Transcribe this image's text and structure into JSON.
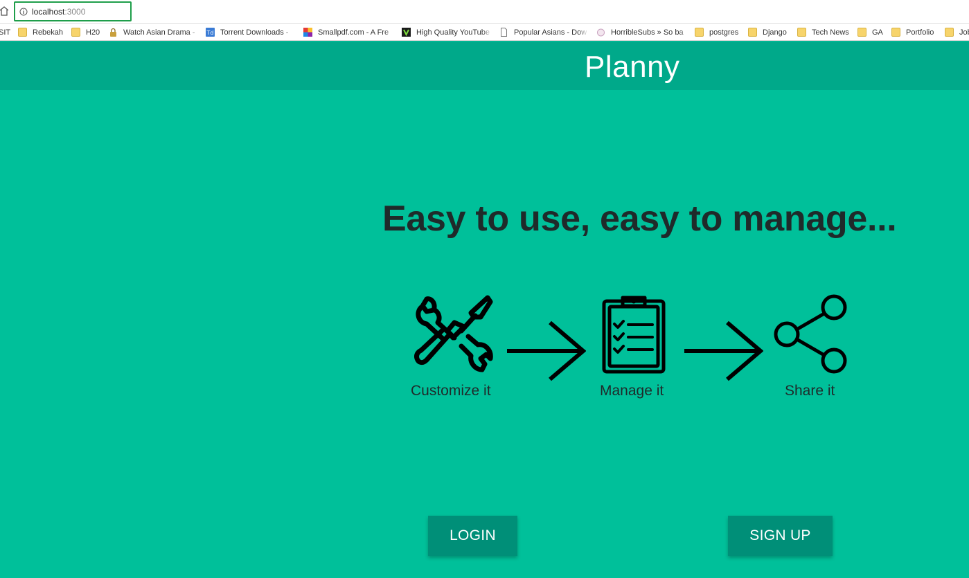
{
  "browser": {
    "url_host": "localhost",
    "url_port": ":3000",
    "bookmarks": [
      {
        "label": "SIT",
        "icon": "none"
      },
      {
        "label": "Rebekah",
        "icon": "folder-icon"
      },
      {
        "label": "H20",
        "icon": "folder-icon"
      },
      {
        "label": "Watch Asian Drama -",
        "icon": "lock-icon"
      },
      {
        "label": "Torrent Downloads -",
        "icon": "td-icon"
      },
      {
        "label": "Smallpdf.com - A Fre",
        "icon": "smallpdf-icon"
      },
      {
        "label": "High Quality YouTube",
        "icon": "v-icon"
      },
      {
        "label": "Popular Asians - Dow",
        "icon": "page-icon"
      },
      {
        "label": "HorribleSubs » So ba",
        "icon": "hs-icon"
      },
      {
        "label": "postgres",
        "icon": "folder-icon"
      },
      {
        "label": "Django",
        "icon": "folder-icon"
      },
      {
        "label": "Tech News",
        "icon": "folder-icon"
      },
      {
        "label": "GA",
        "icon": "folder-icon"
      },
      {
        "label": "Portfolio",
        "icon": "folder-icon"
      },
      {
        "label": "Job",
        "icon": "folder-icon"
      }
    ]
  },
  "app": {
    "title": "Planny",
    "tagline": "Easy to use, easy to manage...",
    "steps": [
      {
        "label": "Customize it",
        "icon": "tools-icon"
      },
      {
        "label": "Manage it",
        "icon": "clipboard-checklist-icon"
      },
      {
        "label": "Share it",
        "icon": "share-icon"
      }
    ],
    "arrow_icon": "arrow-right-icon",
    "login_label": "LOGIN",
    "signup_label": "SIGN UP"
  },
  "colors": {
    "background": "#00c09a",
    "header": "#00a98a",
    "button": "#008f78",
    "text_dark": "#1f2a2a"
  }
}
